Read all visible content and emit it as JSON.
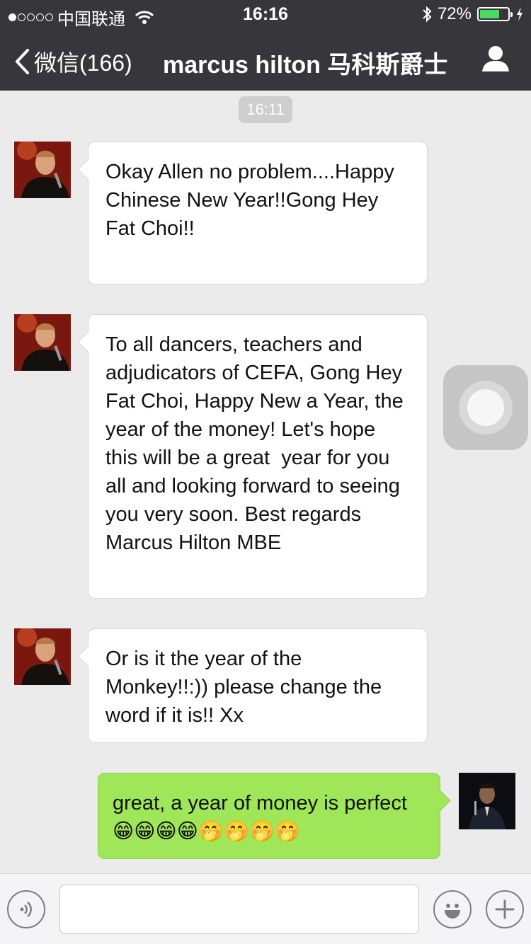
{
  "status_bar": {
    "carrier": "中国联通",
    "time": "16:16",
    "battery": "72%",
    "battery_level": 0.72,
    "colors": {
      "battery_fill": "#4cd964"
    }
  },
  "nav": {
    "back_label": "微信(166)",
    "title": "marcus hilton 马科斯爵士",
    "profile_icon": "person-icon"
  },
  "chat": {
    "timestamp": "16:11",
    "messages": [
      {
        "sender": "marcus hilton",
        "side": "left",
        "text": "Okay Allen no problem....Happy Chinese New Year!!Gong Hey Fat Choi!!"
      },
      {
        "sender": "marcus hilton",
        "side": "left",
        "text": "To all dancers, teachers and adjudicators of CEFA, Gong Hey Fat Choi, Happy New a Year, the year of the money! Let's hope this will be a great  year for you all and looking forward to seeing you very soon. Best regards Marcus Hilton MBE"
      },
      {
        "sender": "marcus hilton",
        "side": "left",
        "text": "Or is it the year of the Monkey!!:)) please change the word if it is!! Xx"
      },
      {
        "sender": "me",
        "side": "right",
        "text": "great, a year of money is perfect 😁😁😁😁🤭🤭🤭🤭"
      }
    ]
  },
  "input_bar": {
    "voice_icon": "voice-icon",
    "text_value": "",
    "emoji_icon": "emoji-icon",
    "plus_icon": "plus-icon"
  },
  "colors": {
    "nav_bg": "#37373b",
    "chat_bg": "#ebebeb",
    "my_bubble": "#9fe658",
    "their_bubble": "#ffffff"
  }
}
